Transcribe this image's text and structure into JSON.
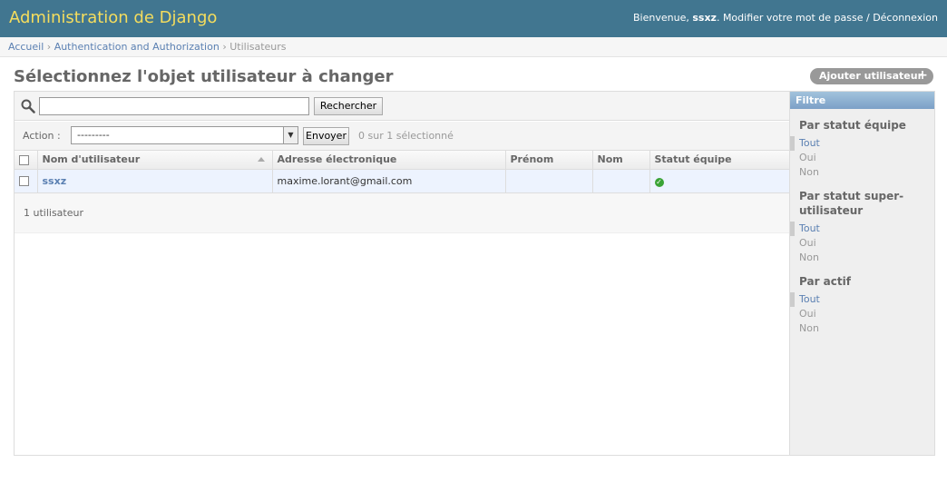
{
  "header": {
    "brand": "Administration de Django",
    "welcome": "Bienvenue,",
    "username": "ssxz",
    "change_password": "Modifier votre mot de passe",
    "separator": "/",
    "logout": "Déconnexion",
    "brand_color": "#f5dd5d",
    "bar_color": "#417690"
  },
  "breadcrumbs": {
    "home": "Accueil",
    "app": "Authentication and Authorization",
    "current": "Utilisateurs",
    "separator": "›"
  },
  "page": {
    "title": "Sélectionnez l'objet utilisateur à changer",
    "add_button": "Ajouter utilisateur"
  },
  "search": {
    "value": "",
    "button": "Rechercher"
  },
  "actions": {
    "label": "Action :",
    "selected_option": "---------",
    "go_button": "Envoyer",
    "counter": "0 sur 1 sélectionné"
  },
  "table": {
    "columns": [
      "Nom d'utilisateur",
      "Adresse électronique",
      "Prénom",
      "Nom",
      "Statut équipe"
    ],
    "rows": [
      {
        "username": "ssxz",
        "email": "maxime.lorant@gmail.com",
        "first_name": "",
        "last_name": "",
        "is_staff": true
      }
    ]
  },
  "paginator": "1 utilisateur",
  "filter": {
    "title": "Filtre",
    "groups": [
      {
        "title": "Par statut équipe",
        "options": [
          "Tout",
          "Oui",
          "Non"
        ],
        "selected": "Tout"
      },
      {
        "title": "Par statut super-utilisateur",
        "options": [
          "Tout",
          "Oui",
          "Non"
        ],
        "selected": "Tout"
      },
      {
        "title": "Par actif",
        "options": [
          "Tout",
          "Oui",
          "Non"
        ],
        "selected": "Tout"
      }
    ]
  }
}
